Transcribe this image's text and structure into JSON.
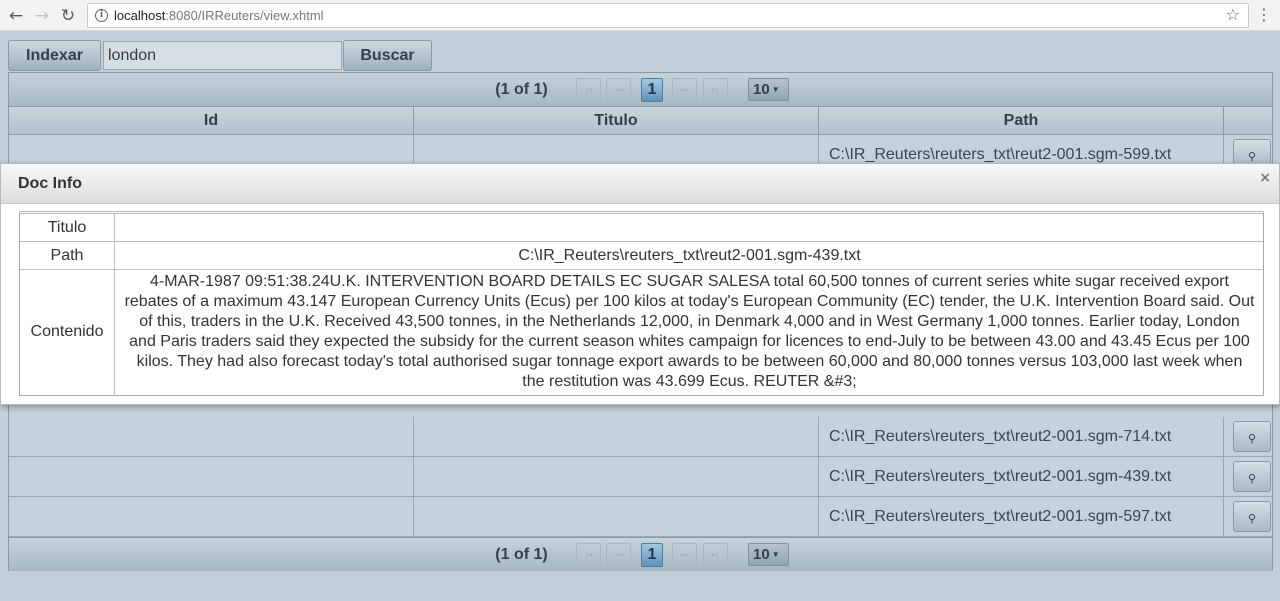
{
  "browser": {
    "url_host": "localhost",
    "url_rest": ":8080/IRReuters/view.xhtml",
    "back_icon": "←",
    "forward_icon": "→",
    "reload_icon": "↻"
  },
  "form": {
    "index_button": "Indexar",
    "search_value": "london",
    "search_button": "Buscar"
  },
  "paginator": {
    "current": "(1 of 1)",
    "page": "1",
    "rows_per_page": "10"
  },
  "table": {
    "headers": [
      "Id",
      "Titulo",
      "Path"
    ],
    "rows": [
      {
        "id": "",
        "titulo": "",
        "path": "C:\\IR_Reuters\\reuters_txt\\reut2-001.sgm-599.txt"
      },
      {
        "id": "",
        "titulo": "",
        "path": "C:\\IR_Reuters\\reuters_txt\\reut2-001.sgm-714.txt"
      },
      {
        "id": "",
        "titulo": "",
        "path": "C:\\IR_Reuters\\reuters_txt\\reut2-001.sgm-439.txt"
      },
      {
        "id": "",
        "titulo": "",
        "path": "C:\\IR_Reuters\\reuters_txt\\reut2-001.sgm-597.txt"
      }
    ]
  },
  "dialog": {
    "title": "Doc Info",
    "close": "×",
    "labels": {
      "titulo": "Titulo",
      "path": "Path",
      "contenido": "Contenido"
    },
    "titulo_value": "",
    "path_value": "C:\\IR_Reuters\\reuters_txt\\reut2-001.sgm-439.txt",
    "contenido_value": "4-MAR-1987 09:51:38.24U.K. INTERVENTION BOARD DETAILS EC SUGAR SALESA total 60,500 tonnes of current series white sugar received export rebates of a maximum 43.147 European Currency Units (Ecus) per 100 kilos at today's European Community (EC) tender, the U.K. Intervention Board said. Out of this, traders in the U.K. Received 43,500 tonnes, in the Netherlands 12,000, in Denmark 4,000 and in West Germany 1,000 tonnes. Earlier today, London and Paris traders said they expected the subsidy for the current season whites campaign for licences to end-July to be between 43.00 and 43.45 Ecus per 100 kilos. They had also forecast today's total authorised sugar tonnage export awards to be between 60,000 and 80,000 tonnes versus 103,000 last week when the restitution was 43.699 Ecus. REUTER &#3;"
  }
}
